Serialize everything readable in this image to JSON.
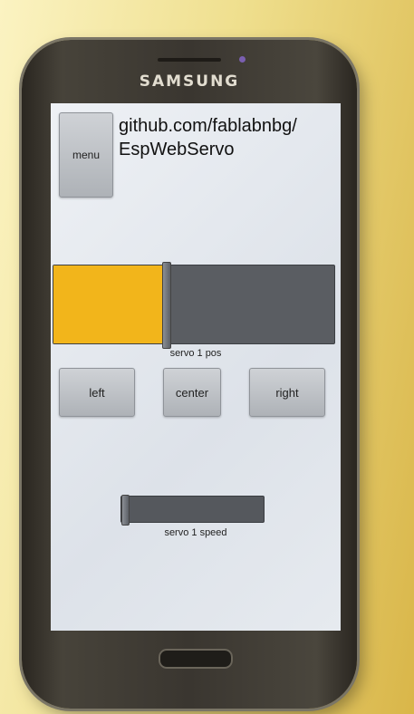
{
  "device": {
    "brand": "SAMSUNG"
  },
  "header": {
    "menu_label": "menu",
    "title": "github.com/fablabnbg/\nEspWebServo"
  },
  "servo_position": {
    "caption": "servo 1 pos",
    "value_fraction": 0.4
  },
  "direction_buttons": {
    "left_label": "left",
    "center_label": "center",
    "right_label": "right"
  },
  "servo_speed": {
    "caption": "servo 1 speed",
    "value_fraction": 0.0
  },
  "colors": {
    "accent": "#f2b51b",
    "track": "#5a5d62"
  }
}
